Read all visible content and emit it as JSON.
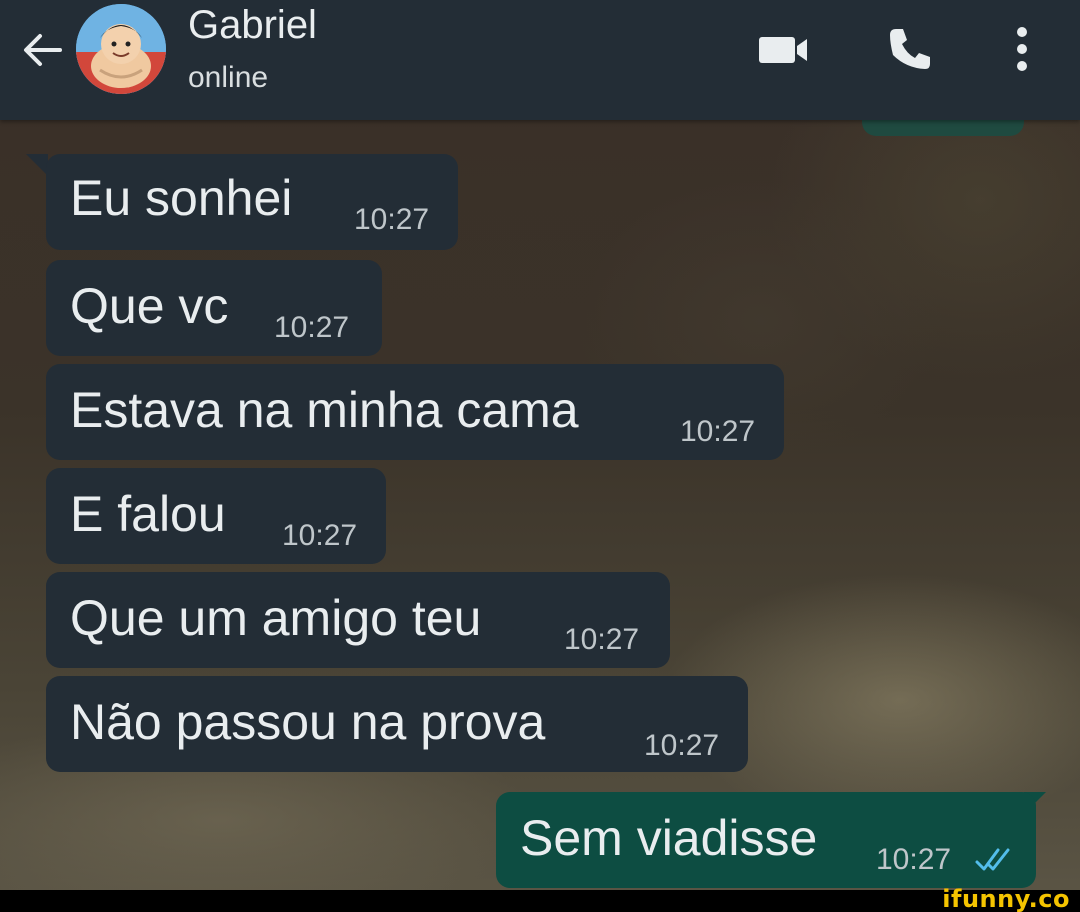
{
  "header": {
    "contact_name": "Gabriel",
    "status": "online",
    "icons": {
      "back": "back-arrow-icon",
      "avatar": "avatar",
      "video": "video-call-icon",
      "call": "phone-icon",
      "menu": "more-vert-icon"
    }
  },
  "messages": [
    {
      "text": "Eu sonhei",
      "time": "10:27",
      "direction": "incoming"
    },
    {
      "text": "Que vc",
      "time": "10:27",
      "direction": "incoming"
    },
    {
      "text": "Estava na minha cama",
      "time": "10:27",
      "direction": "incoming"
    },
    {
      "text": "E falou",
      "time": "10:27",
      "direction": "incoming"
    },
    {
      "text": "Que um amigo teu",
      "time": "10:27",
      "direction": "incoming"
    },
    {
      "text": "Não passou na prova",
      "time": "10:27",
      "direction": "incoming"
    },
    {
      "text": "Sem viadisse",
      "time": "10:27",
      "direction": "outgoing",
      "status": "read"
    }
  ],
  "watermark": "ifunny.co",
  "colors": {
    "header_bg": "#232d36",
    "incoming_bubble": "#232d36",
    "outgoing_bubble": "#0d4d42",
    "read_check": "#53bdeb",
    "text": "#e9edef",
    "watermark": "#f5c400"
  }
}
